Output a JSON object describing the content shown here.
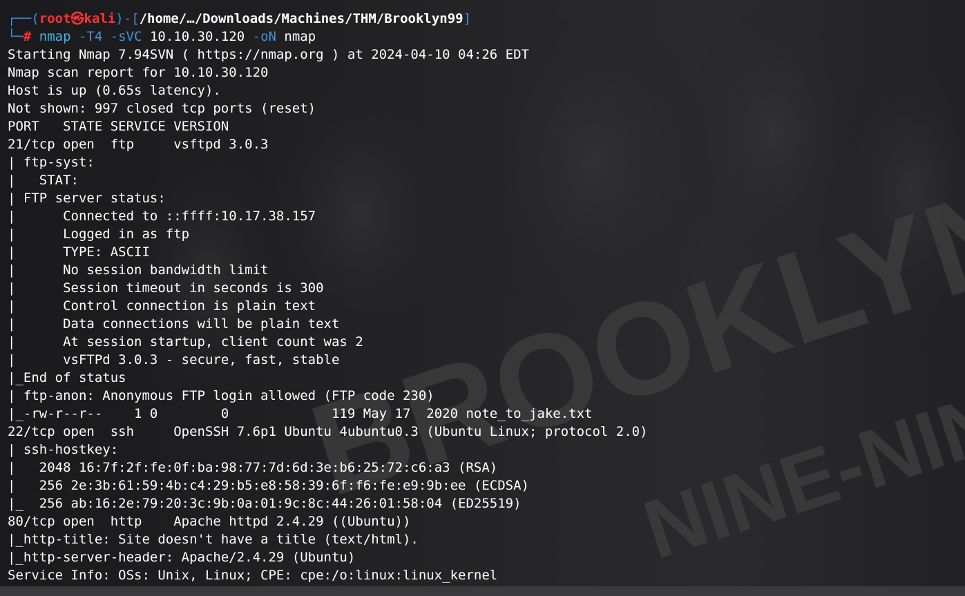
{
  "prompt": {
    "corner_top": "┌──(",
    "user": "root㉿kali",
    "sep": ")-[",
    "path": "/home/…/Downloads/Machines/THM/Brooklyn99",
    "close": "]",
    "corner_bottom": "└─",
    "hash": "# ",
    "cmd": "nmap",
    "flag1": " -T4 -sVC ",
    "arg1": "10.10.30.120",
    "flag2": " -oN ",
    "arg2": "nmap"
  },
  "output_lines": [
    "Starting Nmap 7.94SVN ( https://nmap.org ) at 2024-04-10 04:26 EDT",
    "Nmap scan report for 10.10.30.120",
    "Host is up (0.65s latency).",
    "Not shown: 997 closed tcp ports (reset)",
    "PORT   STATE SERVICE VERSION",
    "21/tcp open  ftp     vsftpd 3.0.3",
    "| ftp-syst: ",
    "|   STAT: ",
    "| FTP server status:",
    "|      Connected to ::ffff:10.17.38.157",
    "|      Logged in as ftp",
    "|      TYPE: ASCII",
    "|      No session bandwidth limit",
    "|      Session timeout in seconds is 300",
    "|      Control connection is plain text",
    "|      Data connections will be plain text",
    "|      At session startup, client count was 2",
    "|      vsFTPd 3.0.3 - secure, fast, stable",
    "|_End of status",
    "| ftp-anon: Anonymous FTP login allowed (FTP code 230)",
    "|_-rw-r--r--    1 0        0             119 May 17  2020 note_to_jake.txt",
    "22/tcp open  ssh     OpenSSH 7.6p1 Ubuntu 4ubuntu0.3 (Ubuntu Linux; protocol 2.0)",
    "| ssh-hostkey: ",
    "|   2048 16:7f:2f:fe:0f:ba:98:77:7d:6d:3e:b6:25:72:c6:a3 (RSA)",
    "|   256 2e:3b:61:59:4b:c4:29:b5:e8:58:39:6f:f6:fe:e9:9b:ee (ECDSA)",
    "|_  256 ab:16:2e:79:20:3c:9b:0a:01:9c:8c:44:26:01:58:04 (ED25519)",
    "80/tcp open  http    Apache httpd 2.4.29 ((Ubuntu))",
    "|_http-title: Site doesn't have a title (text/html).",
    "|_http-server-header: Apache/2.4.29 (Ubuntu)",
    "Service Info: OSs: Unix, Linux; CPE: cpe:/o:linux:linux_kernel"
  ],
  "background": {
    "watermark_words": [
      "BROOKLYN",
      "NINE-NINE"
    ]
  },
  "colors": {
    "prompt_frame": "#3b8eea",
    "prompt_user": "#ff3333",
    "command": "#3fb4e3",
    "text": "#ffffff"
  }
}
